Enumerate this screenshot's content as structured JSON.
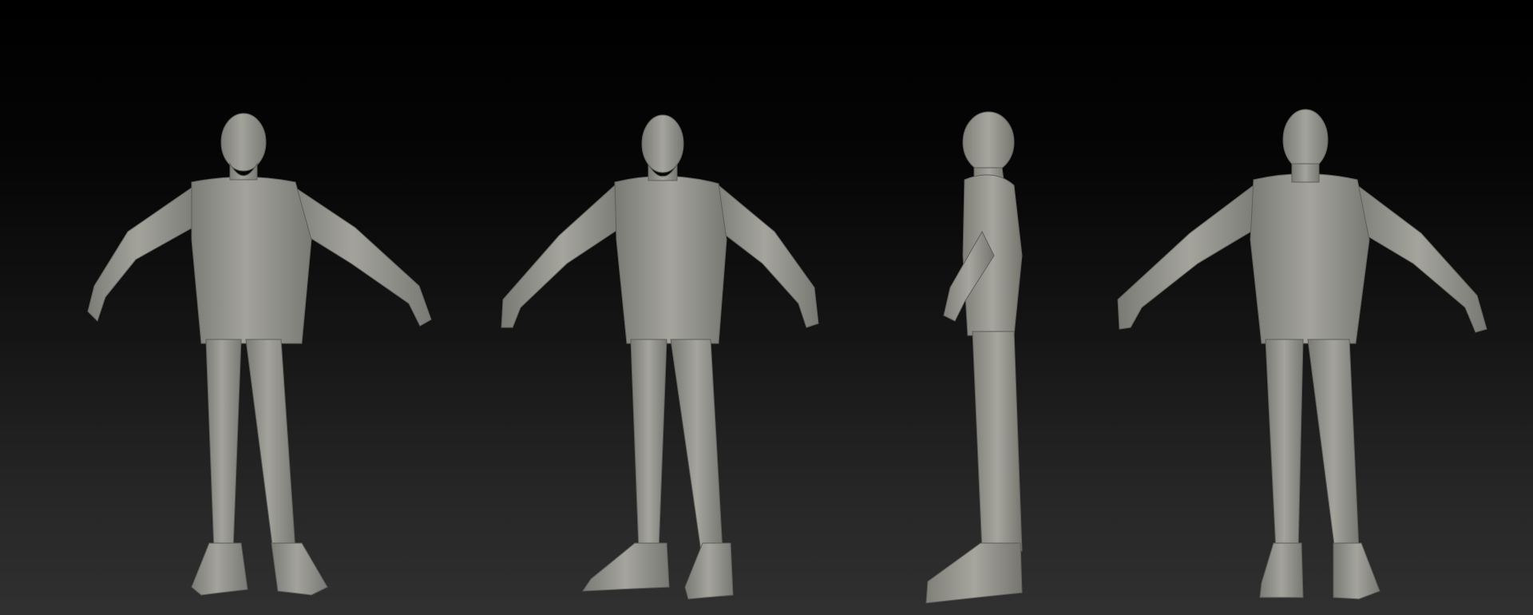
{
  "scene": {
    "background_top": "#000000",
    "background_bottom": "#303030",
    "clay_color": "#9a9a94",
    "clay_shadow": "#6f6f6a",
    "clay_highlight": "#b5b5ae",
    "views": [
      {
        "view": "front"
      },
      {
        "view": "three-quarter"
      },
      {
        "view": "side"
      },
      {
        "view": "back"
      }
    ]
  }
}
